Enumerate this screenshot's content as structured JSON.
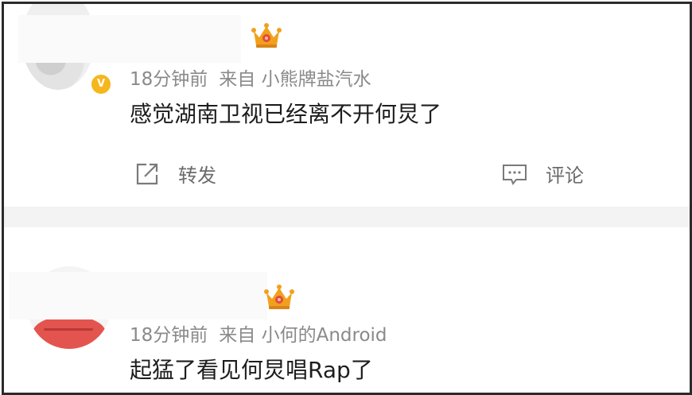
{
  "posts": [
    {
      "time": "18分钟前",
      "source_prefix": "来自",
      "source": "小熊牌盐汽水",
      "verified_badge": "V",
      "text": "感觉湖南卫视已经离不开何炅了",
      "actions": {
        "repost_label": "转发",
        "comment_label": "评论"
      }
    },
    {
      "time": "18分钟前",
      "source_prefix": "来自",
      "source": "小何的Android",
      "text": "起猛了看见何炅唱Rap了"
    }
  ],
  "icons": {
    "repost": "share-external-icon",
    "comment": "comment-bubble-icon",
    "crown": "crown-badge-icon",
    "verified": "verified-v-icon"
  },
  "colors": {
    "meta_text": "#8a8a8a",
    "body_text": "#1d1d1d",
    "action_text": "#6b6b6b",
    "verified": "#f5b61e",
    "crown": "#f2a01c",
    "crown_gem": "#e24b3b",
    "separator": "#f3f3f3",
    "frame_border": "#2b2b2b"
  }
}
